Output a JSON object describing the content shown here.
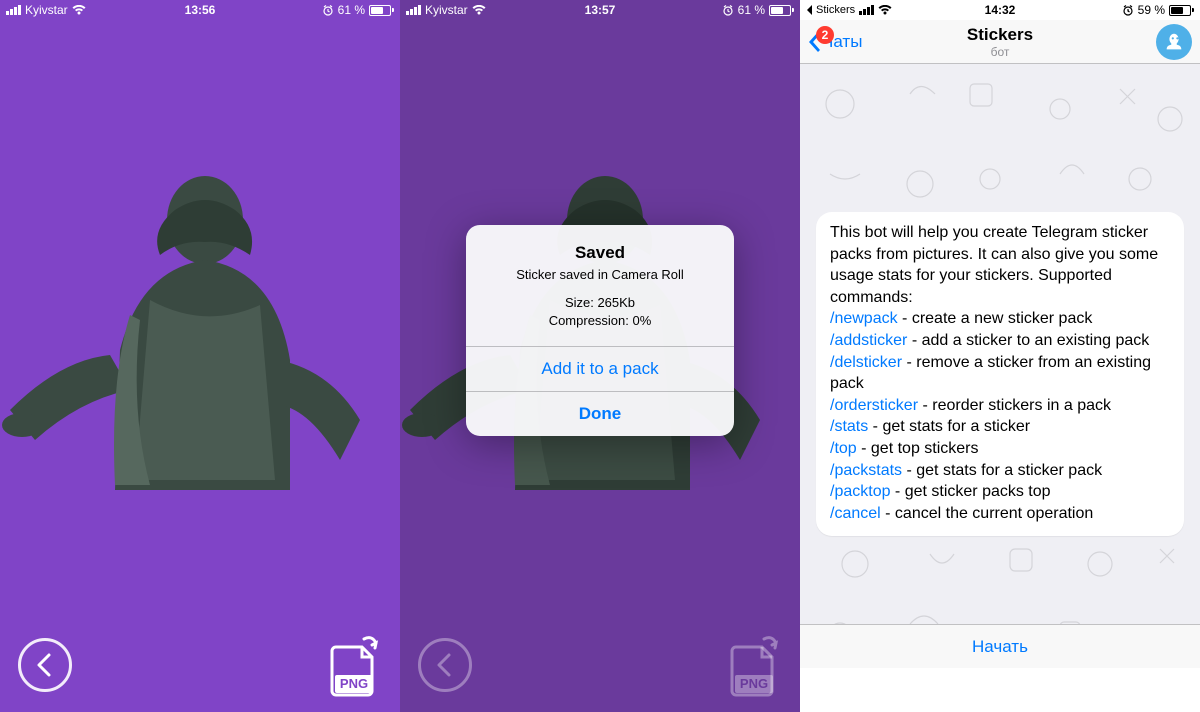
{
  "screen1": {
    "status": {
      "carrier": "Kyivstar",
      "time": "13:56",
      "battery_pct": "61 %",
      "battery_fill": 61
    },
    "png_label": "PNG"
  },
  "screen2": {
    "status": {
      "carrier": "Kyivstar",
      "time": "13:57",
      "battery_pct": "61 %",
      "battery_fill": 61
    },
    "png_label": "PNG",
    "alert": {
      "title": "Saved",
      "message": "Sticker saved in Camera Roll",
      "size_label": "Size: 265Kb",
      "compression_label": "Compression: 0%",
      "add_button": "Add it to a pack",
      "done_button": "Done"
    }
  },
  "screen3": {
    "status": {
      "back_app": "Stickers",
      "time": "14:32",
      "battery_pct": "59 %",
      "battery_fill": 59
    },
    "nav": {
      "back_label": "Чаты",
      "badge": "2",
      "title": "Stickers",
      "subtitle": "бот"
    },
    "bubble": {
      "intro": "This bot will help you create Telegram sticker packs from pictures. It can also give you some usage stats for your stickers. Supported commands:",
      "commands": [
        {
          "cmd": "/newpack",
          "desc": " - create a new sticker pack"
        },
        {
          "cmd": "/addsticker",
          "desc": " - add a sticker to an existing pack"
        },
        {
          "cmd": "/delsticker",
          "desc": " - remove a sticker from an existing pack"
        },
        {
          "cmd": "/ordersticker",
          "desc": " - reorder stickers in a pack"
        },
        {
          "cmd": "/stats",
          "desc": " - get stats for a sticker"
        },
        {
          "cmd": "/top",
          "desc": " - get top stickers"
        },
        {
          "cmd": "/packstats",
          "desc": " - get stats for a sticker pack"
        },
        {
          "cmd": "/packtop",
          "desc": " - get sticker packs top"
        },
        {
          "cmd": "/cancel",
          "desc": " - cancel the current operation"
        }
      ]
    },
    "start_button": "Начать"
  }
}
